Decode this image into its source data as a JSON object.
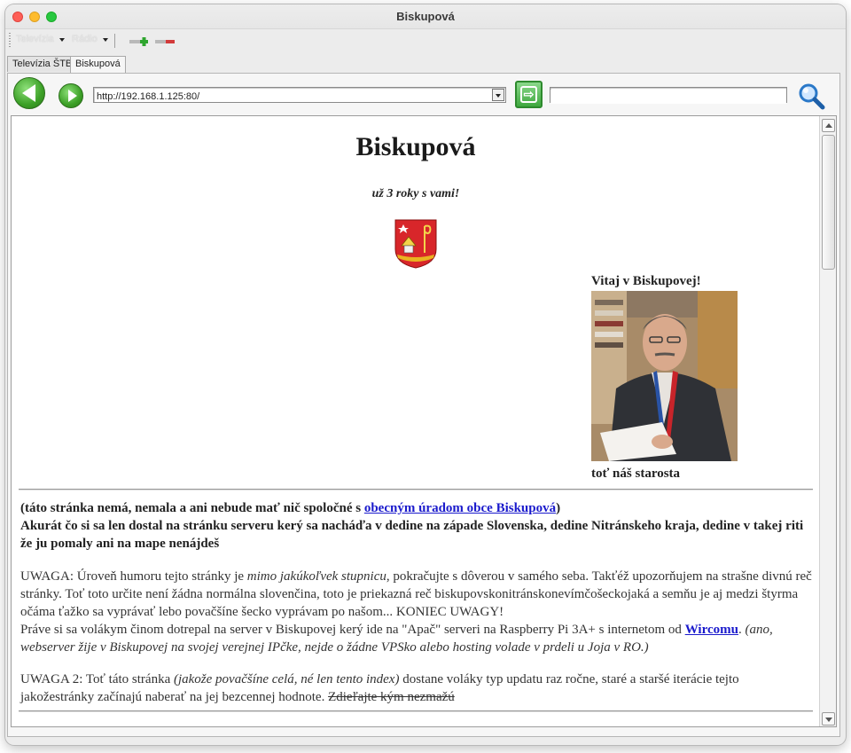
{
  "window": {
    "title": "Biskupová"
  },
  "menu": {
    "items": [
      "Televízia",
      "Rádio"
    ]
  },
  "tabs": [
    {
      "label": "Televízia ŠTB",
      "active": false
    },
    {
      "label": "Biskupová",
      "active": true
    }
  ],
  "navbar": {
    "url": "http://192.168.1.125:80/",
    "search_value": ""
  },
  "page": {
    "title": "Biskupová",
    "tagline": "už 3 roky s vami!",
    "welcome": "Vitaj v Biskupovej!",
    "photo_caption": "toť náš starosta",
    "notice_pre": "(táto stránka nemá, nemala a ani nebude mať nič spoločné s ",
    "notice_link": "obecným úradom obce Biskupová",
    "notice_post": ")",
    "notice_line2": "Akurát čo si sa len dostal na stránku serveru kerý sa nacháďa v dedine na západe Slovenska, dedine Nitránskeho kraja, dedine v takej riti že ju pomaly ani na mape nenájdeš",
    "warn1_a": "UWAGA: Úroveň humoru tejto stránky je ",
    "warn1_em": "mimo jakúkoľvek stupnicu",
    "warn1_b": ", pokračujte s dôverou v samého seba. Takťéž upozorňujem na strašne divnú reč stránky. Toť toto určite není žádna normálna slovenčina, toto je priekazná reč biskupovskonitránskonevímčošeckojaká a semňu je aj medzi štyrma očáma ťažko sa vyprávať lebo povačšíne šecko vyprávam po našom... KONIEC UWAGY!",
    "warn1_c": "Práve si sa volákym činom dotrepal na server v Biskupovej kerý ide na \"Apač\" serveri na Raspberry Pi 3A+ s internetom od ",
    "warn1_link": "Wircomu",
    "warn1_d": ". ",
    "warn1_em2": "(ano, webserver žije v Biskupovej na svojej verejnej IPčke, nejde o žádne VPSko alebo hosting volade v prdeli u Joja v RO.)",
    "warn2_a": "UWAGA 2: Toť táto stránka ",
    "warn2_em": "(jakože povačšíne celá, né len tento index)",
    "warn2_b": " dostane voláky typ updatu raz ročne, staré a staršé iterácie tejto jakožestránky začínajú naberať na jej bezcennej hodnote. ",
    "warn2_strike": "Zdieľajte kým nezmažú"
  },
  "icons": {
    "back": "back-arrow-icon",
    "forward": "forward-arrow-icon",
    "go": "go-icon",
    "search": "magnifier-icon",
    "zoom_in": "zoom-in-icon",
    "zoom_out": "zoom-out-icon",
    "coat_of_arms": "coat-of-arms-icon"
  },
  "colors": {
    "accent_green": "#3ca027",
    "link": "#1a1acc"
  }
}
